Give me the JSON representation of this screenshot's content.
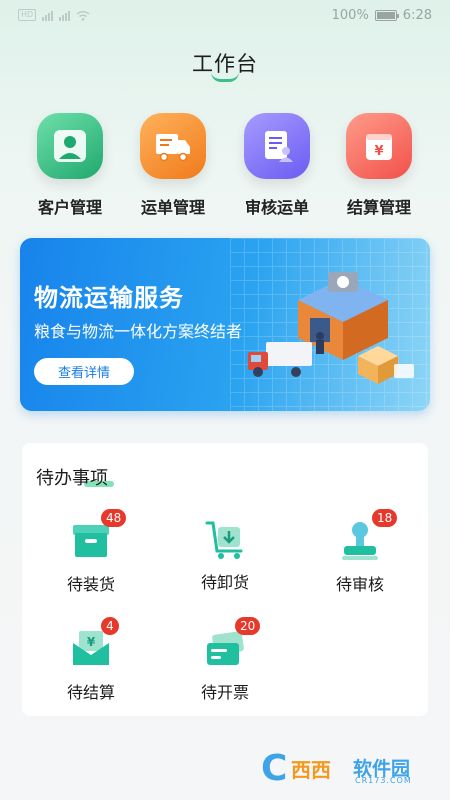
{
  "status_bar": {
    "left_tag": "HD",
    "battery": "100%",
    "time": "6:28"
  },
  "page": {
    "title": "工作台"
  },
  "quick_actions": [
    {
      "label": "客户管理",
      "icon": "customer-icon",
      "color": "#1fa86f"
    },
    {
      "label": "运单管理",
      "icon": "truck-icon",
      "color": "#f07a1b"
    },
    {
      "label": "审核运单",
      "icon": "audit-document-icon",
      "color": "#6a5cf2"
    },
    {
      "label": "结算管理",
      "icon": "yuan-wallet-icon",
      "color": "#f2504a"
    }
  ],
  "banner": {
    "title": "物流运输服务",
    "subtitle": "粮食与物流一体化方案终结者",
    "button": "查看详情"
  },
  "todo": {
    "title": "待办事项",
    "items": [
      {
        "label": "待装货",
        "badge": "48",
        "icon": "box-load-icon"
      },
      {
        "label": "待卸货",
        "badge": "",
        "icon": "cart-unload-icon"
      },
      {
        "label": "待审核",
        "badge": "18",
        "icon": "stamp-icon"
      },
      {
        "label": "待结算",
        "badge": "4",
        "icon": "yuan-envelope-icon"
      },
      {
        "label": "待开票",
        "badge": "20",
        "icon": "invoice-card-icon"
      }
    ]
  },
  "watermark": {
    "left": "西西",
    "right": "软件园",
    "url": "CR173.COM"
  },
  "colors": {
    "accent": "#3bbf8b",
    "banner_blue": "#1783ec",
    "badge_red": "#e6382b"
  }
}
